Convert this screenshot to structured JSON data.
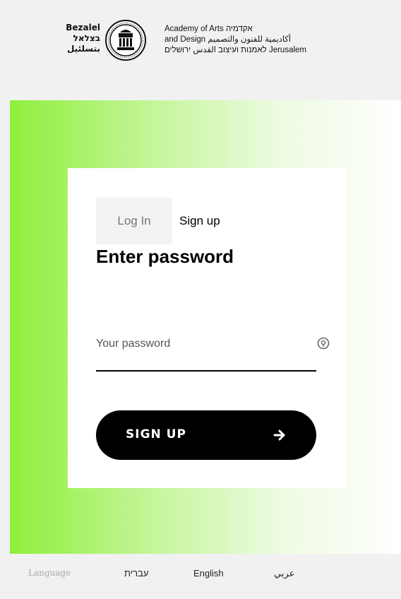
{
  "header": {
    "logo_left": [
      "Bezalel",
      "בצלאל",
      "بتسلئيل"
    ],
    "logo_right": [
      "Academy of Arts אקדמיה",
      "and Design أكاديمية للفنون والتصميم",
      "לאמנות ועיצוב القدس ירושלים Jerusalem"
    ]
  },
  "auth": {
    "tab_login": "Log In",
    "tab_signup": "Sign up",
    "heading": "Enter password",
    "password_placeholder": "Your password",
    "password_value": "",
    "submit_label": "SIGN UP"
  },
  "language": {
    "label": "Language",
    "options": [
      "עברית",
      "English",
      "عربي"
    ]
  },
  "icons": {
    "password_toggle": "eye-icon",
    "submit_arrow": "arrow-right-icon",
    "logo": "bezalel-seal-icon"
  },
  "colors": {
    "hero_gradient_start": "#8fef3c",
    "button": "#000000",
    "background": "#f1f1f1"
  }
}
